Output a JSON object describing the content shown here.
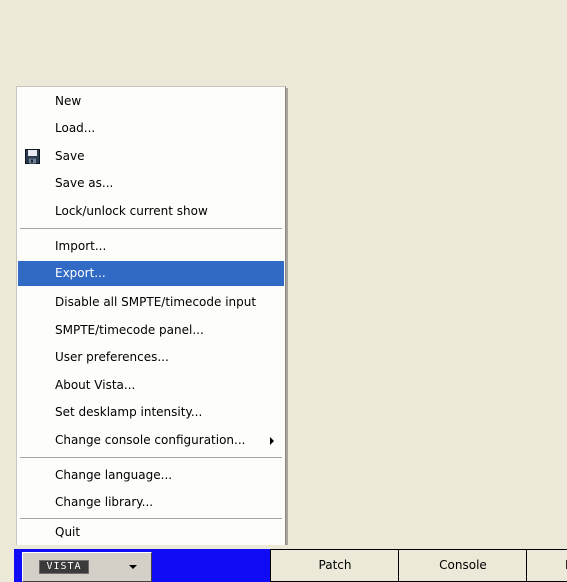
{
  "menu": {
    "items": [
      {
        "label": "New"
      },
      {
        "label": "Load..."
      },
      {
        "label": "Save",
        "icon": "floppy-disk-icon"
      },
      {
        "label": "Save as..."
      },
      {
        "label": "Lock/unlock current show"
      },
      {
        "label": "Import..."
      },
      {
        "label": "Export...",
        "selected": true
      },
      {
        "label": "Disable all SMPTE/timecode input"
      },
      {
        "label": "SMPTE/timecode panel..."
      },
      {
        "label": "User preferences..."
      },
      {
        "label": "About Vista..."
      },
      {
        "label": "Set desklamp intensity..."
      },
      {
        "label": "Change console configuration...",
        "submenu": true
      },
      {
        "label": "Change language..."
      },
      {
        "label": "Change library..."
      },
      {
        "label": "Quit"
      }
    ],
    "highlight_color": "#316ac5"
  },
  "taskbar": {
    "logo_text": "VISTA",
    "logo_color": "#0f0bf5",
    "tabs": [
      {
        "label": "Patch"
      },
      {
        "label": "Console"
      },
      {
        "label": "F"
      }
    ]
  }
}
